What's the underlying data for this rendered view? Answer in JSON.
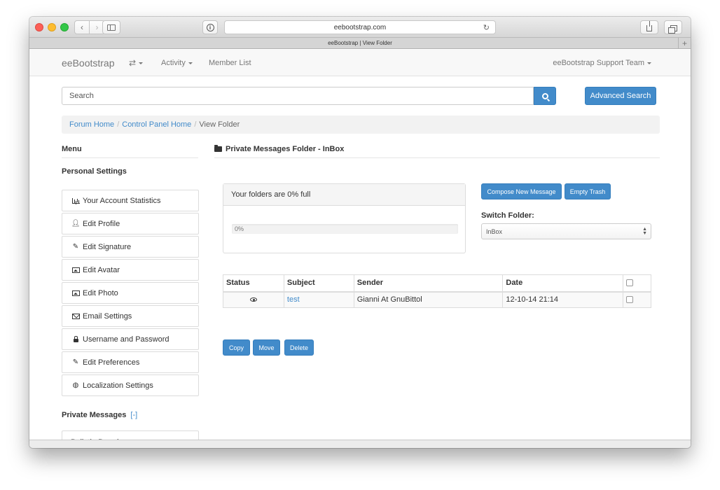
{
  "browser": {
    "url": "eebootstrap.com",
    "tab_title": "eeBootstrap | View Folder"
  },
  "navbar": {
    "brand": "eeBootstrap",
    "tools_icon": "⇄",
    "activity": "Activity",
    "member_list": "Member List",
    "user": "eeBootstrap Support Team"
  },
  "search": {
    "placeholder": "Search",
    "advanced_label": "Advanced Search"
  },
  "breadcrumb": {
    "items": [
      "Forum Home",
      "Control Panel Home"
    ],
    "separator": "/",
    "current": "View Folder"
  },
  "sidebar": {
    "menu_title": "Menu",
    "personal_title": "Personal Settings",
    "items": [
      {
        "label": "Your Account Statistics",
        "icon": "bar-chart-icon"
      },
      {
        "label": "Edit Profile",
        "icon": "user-icon"
      },
      {
        "label": "Edit Signature",
        "icon": "pencil-icon"
      },
      {
        "label": "Edit Avatar",
        "icon": "picture-icon"
      },
      {
        "label": "Edit Photo",
        "icon": "picture-icon"
      },
      {
        "label": "Email Settings",
        "icon": "envelope-icon"
      },
      {
        "label": "Username and Password",
        "icon": "lock-icon"
      },
      {
        "label": "Edit Preferences",
        "icon": "pencil-icon"
      },
      {
        "label": "Localization Settings",
        "icon": "globe-icon"
      }
    ],
    "pm_title": "Private Messages",
    "pm_toggle": "[-]",
    "cut_item": "Bulletin Board"
  },
  "main": {
    "title": "Private Messages Folder - InBox",
    "quota_text": "Your folders are 0% full",
    "progress_label": "0%",
    "progress_value": 0,
    "compose_label": "Compose New Message",
    "empty_trash_label": "Empty Trash",
    "switch_folder_label": "Switch Folder:",
    "selected_folder": "InBox",
    "table": {
      "headers": [
        "Status",
        "Subject",
        "Sender",
        "Date"
      ],
      "rows": [
        {
          "status_icon": "eye-icon",
          "subject": "test",
          "sender": "Gianni At GnuBittol",
          "date": "12-10-14 21:14"
        }
      ]
    },
    "actions": {
      "copy": "Copy",
      "move": "Move",
      "delete": "Delete"
    }
  },
  "colors": {
    "primary": "#428bca",
    "navbar_bg": "#f8f8f8",
    "breadcrumb_bg": "#f2f2f2"
  }
}
